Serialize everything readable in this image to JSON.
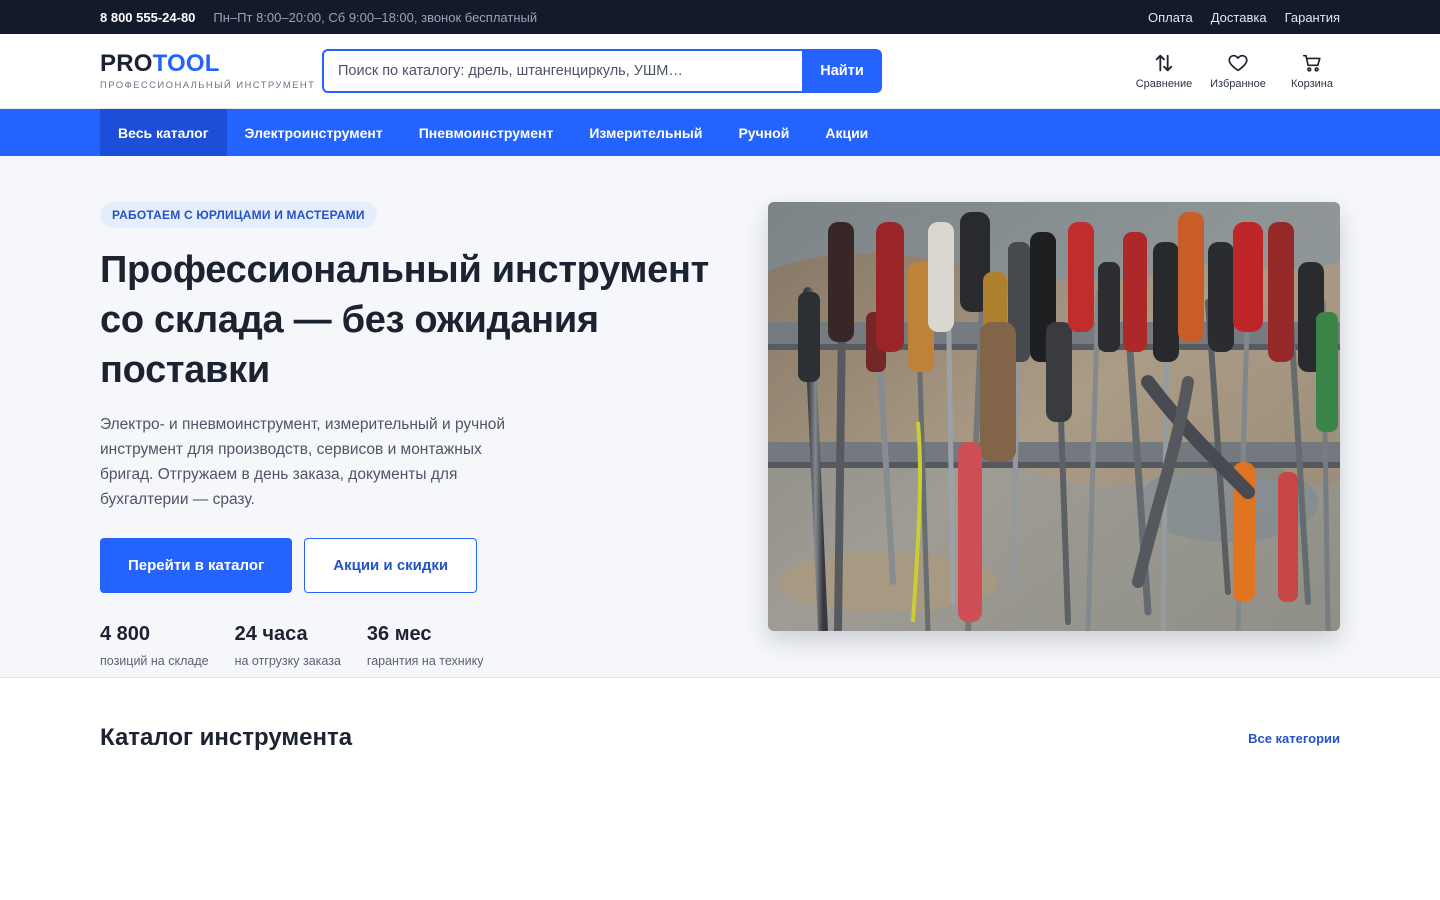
{
  "topbar": {
    "phone": "8 800 555-24-80",
    "hours": "Пн–Пт 8:00–20:00, Сб 9:00–18:00, звонок бесплатный",
    "links": [
      "Оплата",
      "Доставка",
      "Гарантия"
    ]
  },
  "header": {
    "logo_pro": "PRO",
    "logo_tool": "TOOL",
    "logo_sub": "ПРОФЕССИОНАЛЬНЫЙ ИНСТРУМЕНТ",
    "search_placeholder": "Поиск по каталогу: дрель, штангенциркуль, УШМ…",
    "search_button": "Найти",
    "actions": [
      {
        "icon": "compare-icon",
        "label": "Сравнение"
      },
      {
        "icon": "heart-icon",
        "label": "Избранное"
      },
      {
        "icon": "cart-icon",
        "label": "Корзина"
      }
    ]
  },
  "nav": {
    "items": [
      "Весь каталог",
      "Электроинструмент",
      "Пневмоинструмент",
      "Измерительный",
      "Ручной",
      "Акции"
    ],
    "active_index": 0
  },
  "hero": {
    "badge": "РАБОТАЕМ С ЮРЛИЦАМИ И МАСТЕРАМИ",
    "title": "Профессиональный инструмент со склада — без ожидания поставки",
    "lead": "Электро- и пневмоинструмент, измерительный и ручной инструмент для производств, сервисов и монтажных бригад. Отгружаем в день заказа, документы для бухгалтерии — сразу.",
    "primary_button": "Перейти в каталог",
    "secondary_button": "Акции и скидки",
    "stats": [
      {
        "value": "4 800",
        "label": "позиций на складе"
      },
      {
        "value": "24 часа",
        "label": "на отгрузку заказа"
      },
      {
        "value": "36 мес",
        "label": "гарантия на технику"
      }
    ]
  },
  "catalog": {
    "title": "Каталог инструмента",
    "all_link": "Все категории"
  },
  "colors": {
    "accent": "#2563ff",
    "topbar_bg": "#121a2b",
    "hero_bg": "#f5f7fa"
  }
}
